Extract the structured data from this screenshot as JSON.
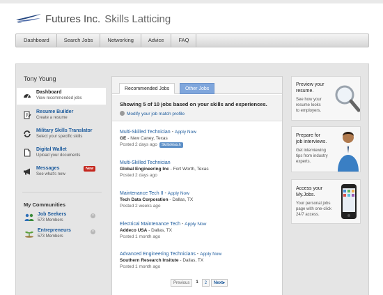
{
  "header": {
    "brand": "Futures Inc.",
    "product": "Skills Latticing"
  },
  "nav": [
    "Dashboard",
    "Search Jobs",
    "Networking",
    "Advice",
    "FAQ"
  ],
  "sidebar": {
    "user_name": "Tony Young",
    "items": [
      {
        "title": "Dashboard",
        "desc": "View recommended jobs",
        "icon": "gauge-icon"
      },
      {
        "title": "Resume Builder",
        "desc": "Create a resume",
        "icon": "document-edit-icon"
      },
      {
        "title": "Military Skills Translator",
        "desc": "Select your specific skills",
        "icon": "refresh-arrows-icon"
      },
      {
        "title": "Digital Wallet",
        "desc": "Upload your documents",
        "icon": "document-icon"
      },
      {
        "title": "Messages",
        "desc": "See what's new",
        "icon": "megaphone-icon",
        "badge": "New"
      }
    ],
    "communities_title": "My Communities",
    "communities": [
      {
        "title": "Job Seekers",
        "members": "573 Members",
        "icon": "people-icon"
      },
      {
        "title": "Entrepreneurs",
        "members": "573 Members",
        "icon": "money-icon"
      }
    ]
  },
  "main": {
    "tabs": [
      "Recommended Jobs",
      "Other Jobs"
    ],
    "summary": "Showing 5 of 10 jobs based on your skills and experiences.",
    "modify_link": "Modify your job match profile",
    "jobs": [
      {
        "title": "Multi-Skilled Technician",
        "apply": "Apply Now",
        "company": "GE",
        "location": "New Caney, Texas",
        "posted": "Posted 2 days ago",
        "badge": "SkillsMatch"
      },
      {
        "title": "Multi-Skilled Technician",
        "apply": "Apply Now",
        "company": "Global Engineering Inc",
        "location": "Fort Worth, Texas",
        "posted": "Posted 2 days ago"
      },
      {
        "title": "Maintenance Tech II",
        "apply": "Apply Now",
        "company": "Tech Data Corporation",
        "location": "Dallas, TX",
        "posted": "Posted 2 weeks ago"
      },
      {
        "title": "Electrical Maintenance Tech",
        "apply": "Apply Now",
        "company": "Addeco USA",
        "location": "Dallas, TX",
        "posted": "Posted 1 month ago"
      },
      {
        "title": "Advanced Engineering Technicians",
        "apply": "Apply Now",
        "company": "Southern Research Insitute",
        "location": "Dallas, TX",
        "posted": "Posted 1 month ago"
      }
    ],
    "pager": {
      "previous": "Previous",
      "pages": [
        "1",
        "2"
      ],
      "next": "Next"
    }
  },
  "promos": [
    {
      "title_1": "Preview your",
      "title_2": "resume.",
      "desc_1": "See how your",
      "desc_2": "resume looks",
      "desc_3": "to employers.",
      "icon": "magnifier-icon"
    },
    {
      "title_1": "Prepare for",
      "title_2": "job interviews.",
      "desc_1": "Get interviewing",
      "desc_2": "tips from industry",
      "desc_3": "experts.",
      "icon": "person-photo"
    },
    {
      "title_1": "Access your",
      "title_2": "My.Jobs.",
      "desc_1": "Your personal jobs",
      "desc_2": "page with one-click",
      "desc_3": "24/7 access.",
      "icon": "smartphone-icon"
    }
  ],
  "colors": {
    "link": "#1b5a9c",
    "tab_other": "#7fa6dc",
    "badge_new": "#c4261d",
    "badge_skills": "#5c8fc7"
  }
}
